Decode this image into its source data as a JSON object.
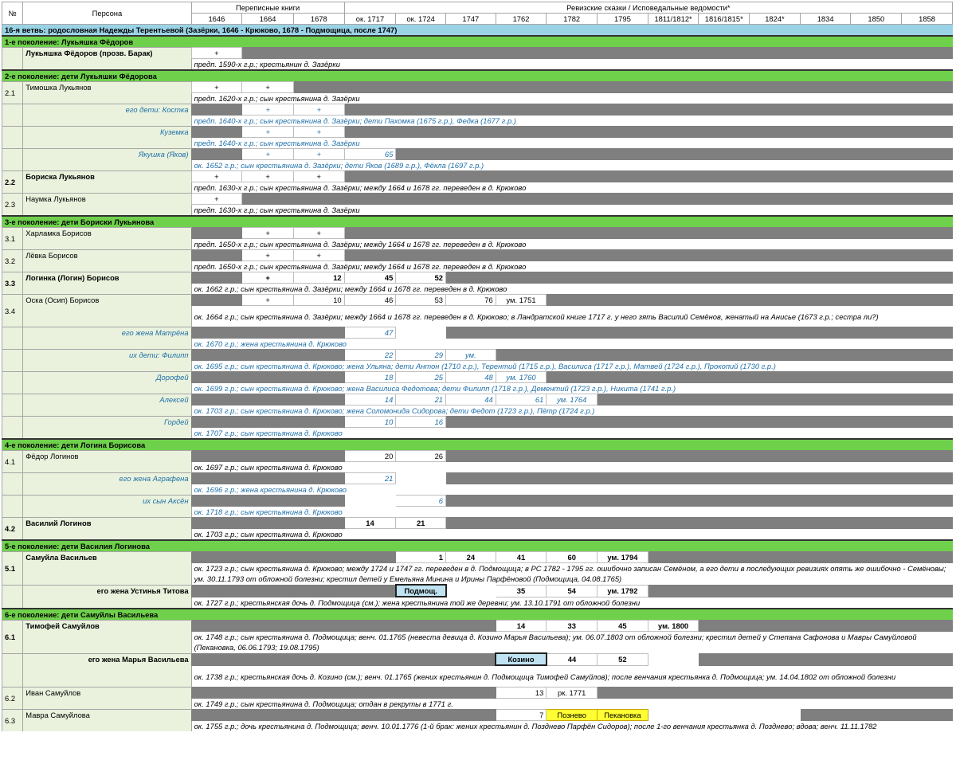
{
  "header": {
    "no": "№",
    "persona": "Персона",
    "perepis": "Переписные книги",
    "revizii": "Ревизские сказки / Исповедальные ведомости*",
    "years": [
      "1646",
      "1664",
      "1678",
      "ок. 1717",
      "ок. 1724",
      "1747",
      "1762",
      "1782",
      "1795",
      "1811/1812*",
      "1816/1815*",
      "1824*",
      "1834",
      "1850",
      "1858"
    ]
  },
  "rows": [
    {
      "type": "branch",
      "text": "16-я ветвь: родословная Надежды Терентьевой (Зазёрки, 1646 - Крюково, 1678 - Подмощица, после 1747)"
    },
    {
      "type": "gen",
      "text": "1-е поколение: Лукьяшка Фёдоров"
    },
    {
      "type": "person",
      "no": "",
      "name": "Лукьяшка Фёдоров (прозв. Барак)",
      "bold": true,
      "cells": [
        "+c",
        "g",
        "g",
        "g",
        "g",
        "g",
        "g",
        "g",
        "g",
        "g",
        "g",
        "g",
        "g",
        "g",
        "g"
      ],
      "note": "предп. 1590-х г.р.; крестьянин д. Зазёрки"
    },
    {
      "type": "gen",
      "text": "2-е поколение: дети Лукьяшки Фёдорова"
    },
    {
      "type": "person",
      "no": "2.1",
      "name": "Тимошка Лукьянов",
      "cells": [
        "+c",
        "+c",
        "g",
        "g",
        "g",
        "g",
        "g",
        "g",
        "g",
        "g",
        "g",
        "g",
        "g",
        "g",
        "g"
      ],
      "note": "предп. 1620-х г.р.; сын крестьянина д. Зазёрки"
    },
    {
      "type": "person",
      "sub": true,
      "no": "",
      "name": "его дети: Костка",
      "cells": [
        "g",
        "+c",
        "+c",
        "g",
        "g",
        "g",
        "g",
        "g",
        "g",
        "g",
        "g",
        "g",
        "g",
        "g",
        "g"
      ],
      "note": "предп. 1640-х г.р.; сын крестьянина д. Зазёрки; дети Пахомка (1675 г.р.), Федка (1677 г.р.)"
    },
    {
      "type": "person",
      "sub": true,
      "no": "",
      "name": "Куземка",
      "cells": [
        "g",
        "+c",
        "+c",
        "g",
        "g",
        "g",
        "g",
        "g",
        "g",
        "g",
        "g",
        "g",
        "g",
        "g",
        "g"
      ],
      "note": "предп. 1640-х г.р.; сын крестьянина д. Зазёрки"
    },
    {
      "type": "person",
      "sub": true,
      "no": "",
      "name": "Якушка (Яков)",
      "cells": [
        "g",
        "+c",
        "+c",
        "65",
        "g",
        "g",
        "g",
        "g",
        "g",
        "g",
        "g",
        "g",
        "g",
        "g",
        "g"
      ],
      "note": "ок. 1652 г.р.; сын крестьянина д. Зазёрки; дети Яков (1689 г.р.), Фёкла (1697 г.р.)"
    },
    {
      "type": "person",
      "no": "2.2",
      "noBold": true,
      "name": "Бориска Лукьянов",
      "bold": true,
      "cells": [
        "+c",
        "+c",
        "+c",
        "g",
        "g",
        "g",
        "g",
        "g",
        "g",
        "g",
        "g",
        "g",
        "g",
        "g",
        "g"
      ],
      "note": "предп. 1630-х г.р.; сын крестьянина д. Зазёрки; между 1664 и 1678 гг. переведен в д. Крюково"
    },
    {
      "type": "person",
      "no": "2.3",
      "name": "Наумка Лукьянов",
      "cells": [
        "+c",
        "g",
        "g",
        "g",
        "g",
        "g",
        "g",
        "g",
        "g",
        "g",
        "g",
        "g",
        "g",
        "g",
        "g"
      ],
      "note": "предп. 1630-х г.р.; сын крестьянина д. Зазёрки"
    },
    {
      "type": "gen",
      "text": "3-е поколение: дети Бориски Лукьянова"
    },
    {
      "type": "person",
      "no": "3.1",
      "name": "Харламка Борисов",
      "cells": [
        "g",
        "+c",
        "+c",
        "g",
        "g",
        "g",
        "g",
        "g",
        "g",
        "g",
        "g",
        "g",
        "g",
        "g",
        "g"
      ],
      "note": "предп. 1650-х г.р.; сын крестьянина д. Зазёрки; между 1664 и 1678 гг. переведен в д. Крюково"
    },
    {
      "type": "person",
      "no": "3.2",
      "name": "Лёвка Борисов",
      "cells": [
        "g",
        "+c",
        "+c",
        "g",
        "g",
        "g",
        "g",
        "g",
        "g",
        "g",
        "g",
        "g",
        "g",
        "g",
        "g"
      ],
      "note": "предп. 1650-х г.р.; сын крестьянина д. Зазёрки; между 1664 и 1678 гг. переведен в д. Крюково"
    },
    {
      "type": "person",
      "no": "3.3",
      "noBold": true,
      "name": "Логинка (Логин) Борисов",
      "bold": true,
      "cells": [
        "g",
        "+c",
        "12",
        "45",
        "52",
        "g",
        "g",
        "g",
        "g",
        "g",
        "g",
        "g",
        "g",
        "g",
        "g"
      ],
      "boldCells": true,
      "note": "ок. 1662 г.р.; сын крестьянина д. Зазёрки; между 1664 и 1678 гг. переведен в д. Крюково"
    },
    {
      "type": "person",
      "no": "3.4",
      "name": "Оска (Осип) Борисов",
      "cells": [
        "g",
        "+c",
        "10",
        "46",
        "53",
        "76",
        "ум. 1751c",
        "g",
        "g",
        "g",
        "g",
        "g",
        "g",
        "g",
        "g"
      ],
      "note": "ок. 1664 г.р.; сын крестьянина д. Зазёрки; между 1664 и 1678 гг. переведен в д. Крюково; в Ландратской книге 1717 г. у него зять Василий Семёнов, женатый на Анисье (1673 г.р.; сестра ли?)",
      "noteTall": true
    },
    {
      "type": "person",
      "sub": true,
      "no": "",
      "name": "его жена Матрёна",
      "cells": [
        "g",
        "g",
        "g",
        "47",
        "e",
        "g",
        "g",
        "g",
        "g",
        "g",
        "g",
        "g",
        "g",
        "g",
        "g"
      ],
      "note": "ок. 1670 г.р.; жена крестьянина д. Крюково"
    },
    {
      "type": "person",
      "sub": true,
      "no": "",
      "name": "их дети: Филипп",
      "cells": [
        "g",
        "g",
        "g",
        "22",
        "29",
        "ум.c",
        "g",
        "g",
        "g",
        "g",
        "g",
        "g",
        "g",
        "g",
        "g"
      ],
      "note": "ок. 1695 г.р.; сын крестьянина д. Крюково; жена Ульяна; дети Антон (1710 г.р.), Терентий (1715 г.р.), Василиса (1717 г.р.), Матвей (1724 г.р.), Прокопий (1730 г.р.)"
    },
    {
      "type": "person",
      "sub": true,
      "no": "",
      "name": "Дорофей",
      "cells": [
        "g",
        "g",
        "g",
        "18",
        "25",
        "48",
        "ум. 1760c",
        "g",
        "g",
        "g",
        "g",
        "g",
        "g",
        "g",
        "g"
      ],
      "note": "ок. 1699 г.р.; сын крестьянина д. Крюково; жена Василиса Федотова; дети Филипп (1718 г.р.), Дементий (1723 г.р.), Никита (1741 г.р.)"
    },
    {
      "type": "person",
      "sub": true,
      "no": "",
      "name": "Алексей",
      "cells": [
        "g",
        "g",
        "g",
        "14",
        "21",
        "44",
        "61",
        "ум. 1764c",
        "g",
        "g",
        "g",
        "g",
        "g",
        "g",
        "g"
      ],
      "note": "ок. 1703 г.р.; сын крестьянина д. Крюково; жена Соломонида Сидорова; дети Федот (1723 г.р.), Пётр (1724 г.р.)"
    },
    {
      "type": "person",
      "sub": true,
      "no": "",
      "name": "Гордей",
      "cells": [
        "g",
        "g",
        "g",
        "10",
        "16",
        "g",
        "g",
        "g",
        "g",
        "g",
        "g",
        "g",
        "g",
        "g",
        "g"
      ],
      "note": "ок. 1707 г.р.; сын крестьянина д. Крюково"
    },
    {
      "type": "gen",
      "text": "4-е поколение: дети Логина Борисова"
    },
    {
      "type": "person",
      "no": "4.1",
      "name": "Фёдор Логинов",
      "cells": [
        "g",
        "g",
        "g",
        "20",
        "26",
        "g",
        "g",
        "g",
        "g",
        "g",
        "g",
        "g",
        "g",
        "g",
        "g"
      ],
      "note": "ок. 1697 г.р.; сын крестьянина д. Крюково"
    },
    {
      "type": "person",
      "sub": true,
      "no": "",
      "name": "его жена Аграфена",
      "cells": [
        "g",
        "g",
        "g",
        "21",
        "e",
        "g",
        "g",
        "g",
        "g",
        "g",
        "g",
        "g",
        "g",
        "g",
        "g"
      ],
      "note": "ок. 1696 г.р.; жена крестьянина д. Крюково"
    },
    {
      "type": "person",
      "sub": true,
      "no": "",
      "name": "их сын Аксён",
      "cells": [
        "g",
        "g",
        "g",
        "e",
        "6",
        "g",
        "g",
        "g",
        "g",
        "g",
        "g",
        "g",
        "g",
        "g",
        "g"
      ],
      "note": "ок. 1718 г.р.; сын крестьянина д. Крюково"
    },
    {
      "type": "person",
      "no": "4.2",
      "noBold": true,
      "name": "Василий Логинов",
      "bold": true,
      "cells": [
        "g",
        "g",
        "g",
        "14c",
        "21c",
        "g",
        "g",
        "g",
        "g",
        "g",
        "g",
        "g",
        "g",
        "g",
        "g"
      ],
      "boldCells": true,
      "note": "ок. 1703 г.р.; сын крестьянина д. Крюково"
    },
    {
      "type": "gen",
      "text": "5-е поколение: дети Василия Логинова"
    },
    {
      "type": "person",
      "no": "5.1",
      "noBold": true,
      "name": "Самуйла Васильев",
      "bold": true,
      "cells": [
        "g",
        "g",
        "g",
        "g",
        "1",
        "24c",
        "41c",
        "60c",
        "ум. 1794c",
        "g",
        "g",
        "g",
        "g",
        "g",
        "g"
      ],
      "boldCells": true,
      "note": "ок. 1723 г.р.; сын крестьянина д. Крюково; между 1724 и 1747 гг. переведен в д. Подмощица; в РС 1782 - 1795 гг. ошибочно записан Семёном, а его дети в последующих ревизиях опять же ошибочно - Семёновы; ум. 30.11.1793 от обложной болезни; крестил детей у Емельяна Минина и Ирины Парфёновой (Подмощица, 04.08.1765)",
      "noteTall": true
    },
    {
      "type": "person",
      "no": "",
      "name": "его жена Устинья Титова",
      "nameRight": true,
      "cells": [
        "g",
        "g",
        "g",
        "g",
        "Подмощ.lb",
        "e",
        "35c",
        "54c",
        "ум. 1792c",
        "g",
        "g",
        "g",
        "g",
        "g",
        "g"
      ],
      "boldCells": true,
      "note": "ок. 1727 г.р.; крестьянская дочь д. Подмощица (см.); жена крестьянина той же деревни; ум. 13.10.1791 от обложной болезни"
    },
    {
      "type": "gen",
      "text": "6-е поколение: дети Самуйлы Васильева"
    },
    {
      "type": "person",
      "no": "6.1",
      "noBold": true,
      "name": "Тимофей Самуйлов",
      "bold": true,
      "cells": [
        "g",
        "g",
        "g",
        "g",
        "g",
        "g",
        "14c",
        "33c",
        "45c",
        "ум. 1800c",
        "g",
        "g",
        "g",
        "g",
        "g"
      ],
      "boldCells": true,
      "note": "ок. 1748 г.р.; сын крестьянина д. Подмощица; венч. 01.1765 (невеста девица д. Козино Марья Васильева); ум. 06.07.1803 от обложной болезни; крестил детей у Степана Сафонова и Мавры Самуйловой (Пекановка, 06.06.1793; 19.08.1795)",
      "noteTall": true
    },
    {
      "type": "person",
      "no": "",
      "name": "его жена Марья Васильева",
      "nameRight": true,
      "cells": [
        "g",
        "g",
        "g",
        "g",
        "g",
        "g",
        "Козиноlb",
        "44c",
        "52c",
        "e",
        "g",
        "g",
        "g",
        "g",
        "g"
      ],
      "boldCells": true,
      "note": "ок. 1738 г.р.; крестьянская дочь д. Козино (см.); венч. 01.1765 (жених крестьянин д. Подмощица Тимофей Самуйлов); после венчания крестьянка д. Подмощица; ум. 14.04.1802 от обложной болезни",
      "noteTall": true
    },
    {
      "type": "person",
      "no": "6.2",
      "name": "Иван Самуйлов",
      "cells": [
        "g",
        "g",
        "g",
        "g",
        "g",
        "g",
        "13",
        "рк. 1771c",
        "g",
        "g",
        "g",
        "g",
        "g",
        "g",
        "g"
      ],
      "note": "ок. 1749 г.р.; сын крестьянина д. Подмощица; отдан в рекруты в 1771 г."
    },
    {
      "type": "person",
      "no": "6.3",
      "name": "Мавра Самуйлова",
      "cells": [
        "g",
        "g",
        "g",
        "g",
        "g",
        "g",
        "7",
        "Позневоyl",
        "Пекановкаyl",
        "e",
        "e",
        "e",
        "g",
        "g",
        "g"
      ],
      "note": "ок. 1755 г.р.; дочь крестьянина д. Подмощица; венч. 10.01.1776 (1-й брак: жених крестьянин д. Позднево Парфён Сидоров); после 1-го венчания крестьянка д. Позднево; вдова; венч. 11.11.1782"
    }
  ]
}
